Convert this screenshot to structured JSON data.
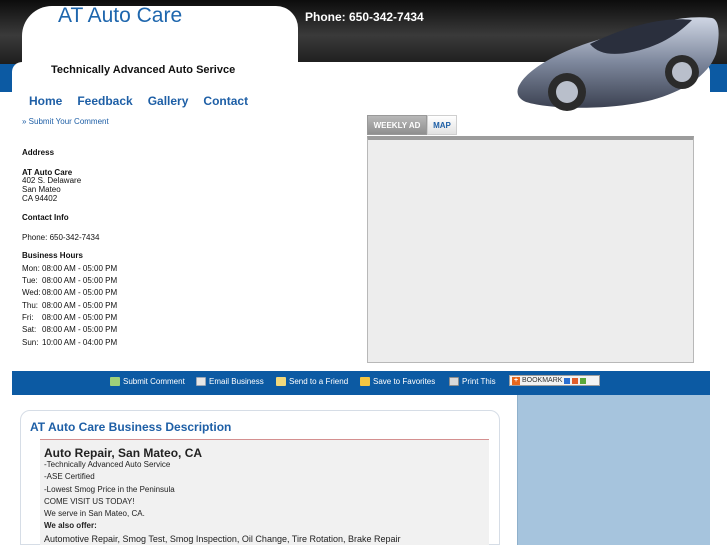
{
  "header": {
    "logo": "AT Auto Care",
    "phone": "Phone:  650-342-7434",
    "tagline": "Technically Advanced Auto Serivce"
  },
  "nav": [
    "Home",
    "Feedback",
    "Gallery",
    "Contact"
  ],
  "submit_link": "» Submit Your Comment",
  "address": {
    "heading": "Address",
    "name": "AT Auto Care",
    "street": "402 S. Delaware",
    "city": "San Mateo",
    "state_zip": "CA 94402"
  },
  "contact": {
    "heading": "Contact Info",
    "phone": "Phone: 650-342-7434"
  },
  "hours": {
    "heading": "Business Hours",
    "rows": [
      {
        "day": "Mon:",
        "time": "08:00 AM - 05:00 PM"
      },
      {
        "day": "Tue:",
        "time": "08:00 AM - 05:00 PM"
      },
      {
        "day": "Wed:",
        "time": "08:00 AM - 05:00 PM"
      },
      {
        "day": "Thu:",
        "time": "08:00 AM - 05:00 PM"
      },
      {
        "day": "Fri:",
        "time": "08:00 AM - 05:00 PM"
      },
      {
        "day": "Sat:",
        "time": "08:00 AM - 05:00 PM"
      },
      {
        "day": "Sun:",
        "time": "10:00 AM - 04:00 PM"
      }
    ]
  },
  "tabs": {
    "weekly": "WEEKLY AD",
    "map": "MAP"
  },
  "actions": {
    "submit": "Submit Comment",
    "email": "Email Business",
    "send": "Send to a Friend",
    "favorites": "Save to Favorites",
    "print": "Print This",
    "bookmark": "BOOKMARK"
  },
  "description": {
    "title": "AT Auto Care Business Description",
    "heading": "Auto Repair, San Mateo, CA",
    "lines": [
      "-Technically Advanced Auto Service",
      "-ASE Certified",
      "-Lowest Smog Price in the Peninsula",
      "COME VISIT US TODAY!",
      "We serve in San Mateo, CA."
    ],
    "offer_label": "We also offer:",
    "services": "Automotive Repair, Smog Test, Smog Inspection, Oil Change, Tire Rotation, Brake Repair"
  },
  "colors": {
    "brand_blue": "#0c5aa3",
    "link_blue": "#1e5fa6",
    "sidebar": "#a6c4dd"
  }
}
